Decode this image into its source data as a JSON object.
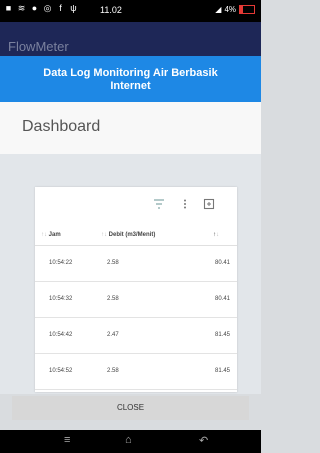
{
  "status_bar": {
    "time": "11.02",
    "battery": "4%"
  },
  "app": {
    "title": "FlowMeter"
  },
  "header": {
    "title_line1": "Data Log Monitoring Air Berbasik",
    "title_line2": "Internet"
  },
  "dashboard": {
    "title": "Dashboard"
  },
  "table": {
    "columns": [
      "Jam",
      "Debit (m3/Menit)",
      ""
    ],
    "rows": [
      {
        "jam": "10:54:22",
        "debit": "2.58",
        "extra": "80.41"
      },
      {
        "jam": "10:54:32",
        "debit": "2.58",
        "extra": "80.41"
      },
      {
        "jam": "10:54:42",
        "debit": "2.47",
        "extra": "81.45"
      },
      {
        "jam": "10:54:52",
        "debit": "2.58",
        "extra": "81.45"
      }
    ]
  },
  "dialog": {
    "close_label": "CLOSE"
  },
  "colors": {
    "header_blue": "#1e88e5",
    "appbar": "#1e2757"
  }
}
